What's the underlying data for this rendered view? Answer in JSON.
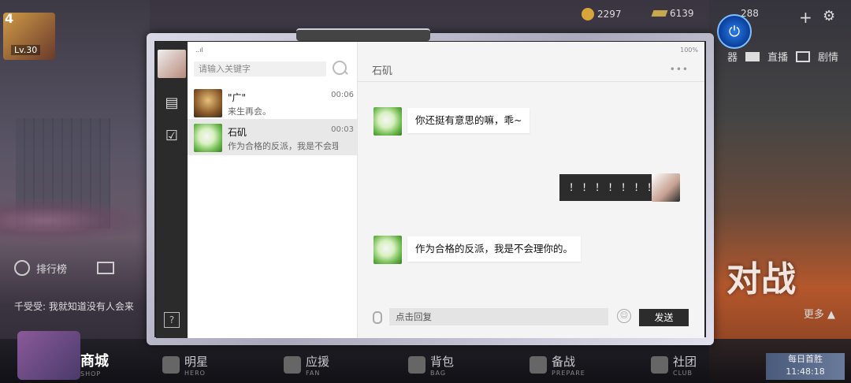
{
  "hud": {
    "level": "Lv.30",
    "level_num": "4",
    "gold": "2297",
    "crystal": "6139",
    "tickets": "288",
    "right_menu": [
      "器",
      "直播",
      "剧情"
    ],
    "battle_label": "对战",
    "more_label": "更多 ▲",
    "left_menu_label": "排行榜",
    "notice": "千受受: 我就知道没有人会来"
  },
  "bottom_nav": [
    {
      "label": "商城",
      "en": "SHOP"
    },
    {
      "label": "明星",
      "en": "HERO"
    },
    {
      "label": "应援",
      "en": "FAN"
    },
    {
      "label": "背包",
      "en": "BAG"
    },
    {
      "label": "备战",
      "en": "PREPARE"
    },
    {
      "label": "社团",
      "en": "CLUB"
    }
  ],
  "daily": {
    "label": "每日首胜",
    "time": "11:48:18"
  },
  "messenger": {
    "signal": "..ıl",
    "battery": "100%",
    "search_placeholder": "请输入关键字",
    "conversations": [
      {
        "name": "\"广\"",
        "time": "00:06",
        "preview": "来生再会。"
      },
      {
        "name": "石矶",
        "time": "00:03",
        "preview": "作为合格的反派，我是不会理"
      }
    ],
    "chat_title": "石矶",
    "more_dots": "•••",
    "messages": [
      {
        "from": "石矶",
        "text": "你还挺有意思的嘛，乖~"
      },
      {
        "from": "me",
        "text": "！！！！！！！"
      },
      {
        "from": "石矶",
        "text": "作为合格的反派，我是不会理你的。"
      }
    ],
    "reply_placeholder": "点击回复",
    "send_label": "发送",
    "help": "?"
  }
}
